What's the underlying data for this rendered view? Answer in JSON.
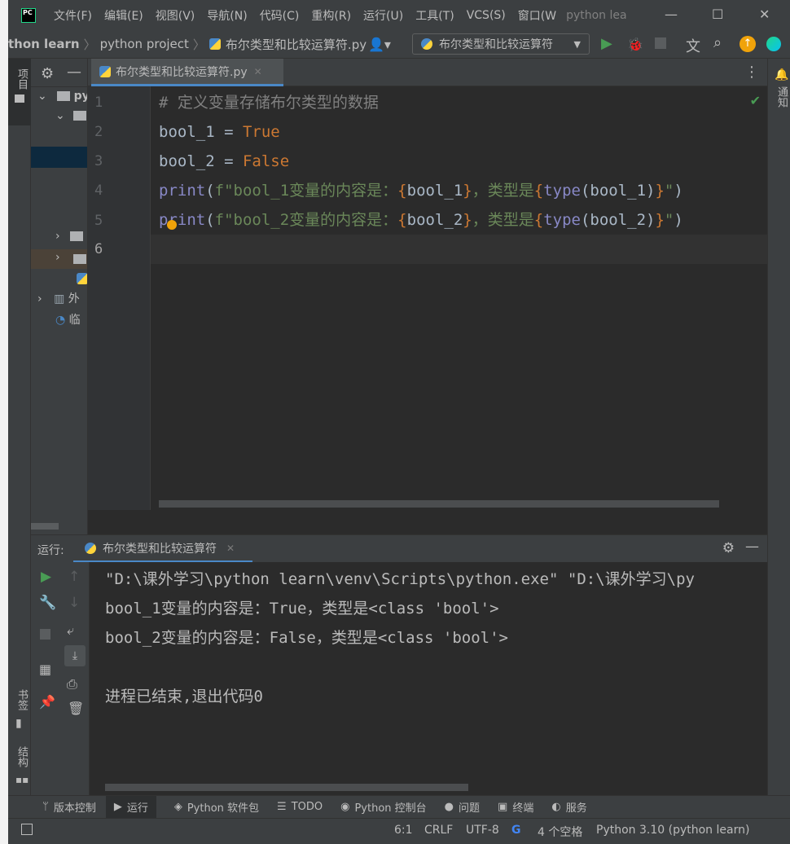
{
  "menu": [
    "文件(F)",
    "编辑(E)",
    "视图(V)",
    "导航(N)",
    "代码(C)",
    "重构(R)",
    "运行(U)",
    "工具(T)",
    "VCS(S)",
    "窗口(W"
  ],
  "window_title": "python lea",
  "window_controls": {
    "minimize": "—",
    "maximize": "☐",
    "close": "✕"
  },
  "breadcrumb": [
    "thon learn",
    "python project",
    "布尔类型和比较运算符.py"
  ],
  "run_config": "布尔类型和比较运算符",
  "left_stripe": {
    "project": "项目",
    "bookmarks": "书签",
    "structure": "结构"
  },
  "right_stripe": {
    "notifications": "通知"
  },
  "project_tree": [
    {
      "label": "py",
      "type": "folder"
    },
    {
      "label": "",
      "type": "folder"
    },
    {
      "label": "",
      "type": "folder"
    },
    {
      "label": "",
      "type": "folder"
    },
    {
      "label": "",
      "type": "file"
    },
    {
      "label": "外",
      "type": "library"
    },
    {
      "label": "临",
      "type": "scratch"
    }
  ],
  "editor_tab": "布尔类型和比较运算符.py",
  "line_numbers": [
    "1",
    "2",
    "3",
    "4",
    "5",
    "6"
  ],
  "code": {
    "l1": "# 定义变量存储布尔类型的数据",
    "l2_var": "bool_1",
    "l2_op": " = ",
    "l2_val": "True",
    "l3_var": "bool_2",
    "l3_op": " = ",
    "l3_val": "False",
    "l4": {
      "fn": "print",
      "p1": "(",
      "s1": "f\"bool_1变量的内容是：",
      "b1": "{",
      "v1": "bool_1",
      "b2": "}",
      "s2": "，类型是",
      "b3": "{",
      "fn2": "type",
      "v2": "(bool_1)",
      "b4": "}",
      "s3": "\"",
      "p2": ")"
    },
    "l5": {
      "fn": "print",
      "p1": "(",
      "s1": "f\"bool_2变量的内容是：",
      "b1": "{",
      "v1": "bool_2",
      "b2": "}",
      "s2": "，类型是",
      "b3": "{",
      "fn2": "type",
      "v2": "(bool_2)",
      "b4": "}",
      "s3": "\"",
      "p2": ")"
    }
  },
  "run_panel": {
    "label": "运行:",
    "tab": "布尔类型和比较运算符",
    "output": [
      "\"D:\\课外学习\\python learn\\venv\\Scripts\\python.exe\" \"D:\\课外学习\\py",
      "bool_1变量的内容是：True，类型是<class 'bool'>",
      "bool_2变量的内容是：False，类型是<class 'bool'>",
      "",
      "进程已结束,退出代码0"
    ]
  },
  "bottom_tools": [
    "版本控制",
    "运行",
    "Python 软件包",
    "TODO",
    "Python 控制台",
    "问题",
    "终端",
    "服务"
  ],
  "status": {
    "position": "6:1",
    "line_sep": "CRLF",
    "encoding": "UTF-8",
    "indent": "4 个空格",
    "interpreter": "Python 3.10 (python learn)"
  },
  "colors": {
    "bg": "#2b2b2b",
    "panel": "#3c3f41",
    "keyword": "#cc7832",
    "string": "#6a8759",
    "builtin": "#8888c6",
    "comment": "#808080",
    "accent": "#4a88c7"
  }
}
